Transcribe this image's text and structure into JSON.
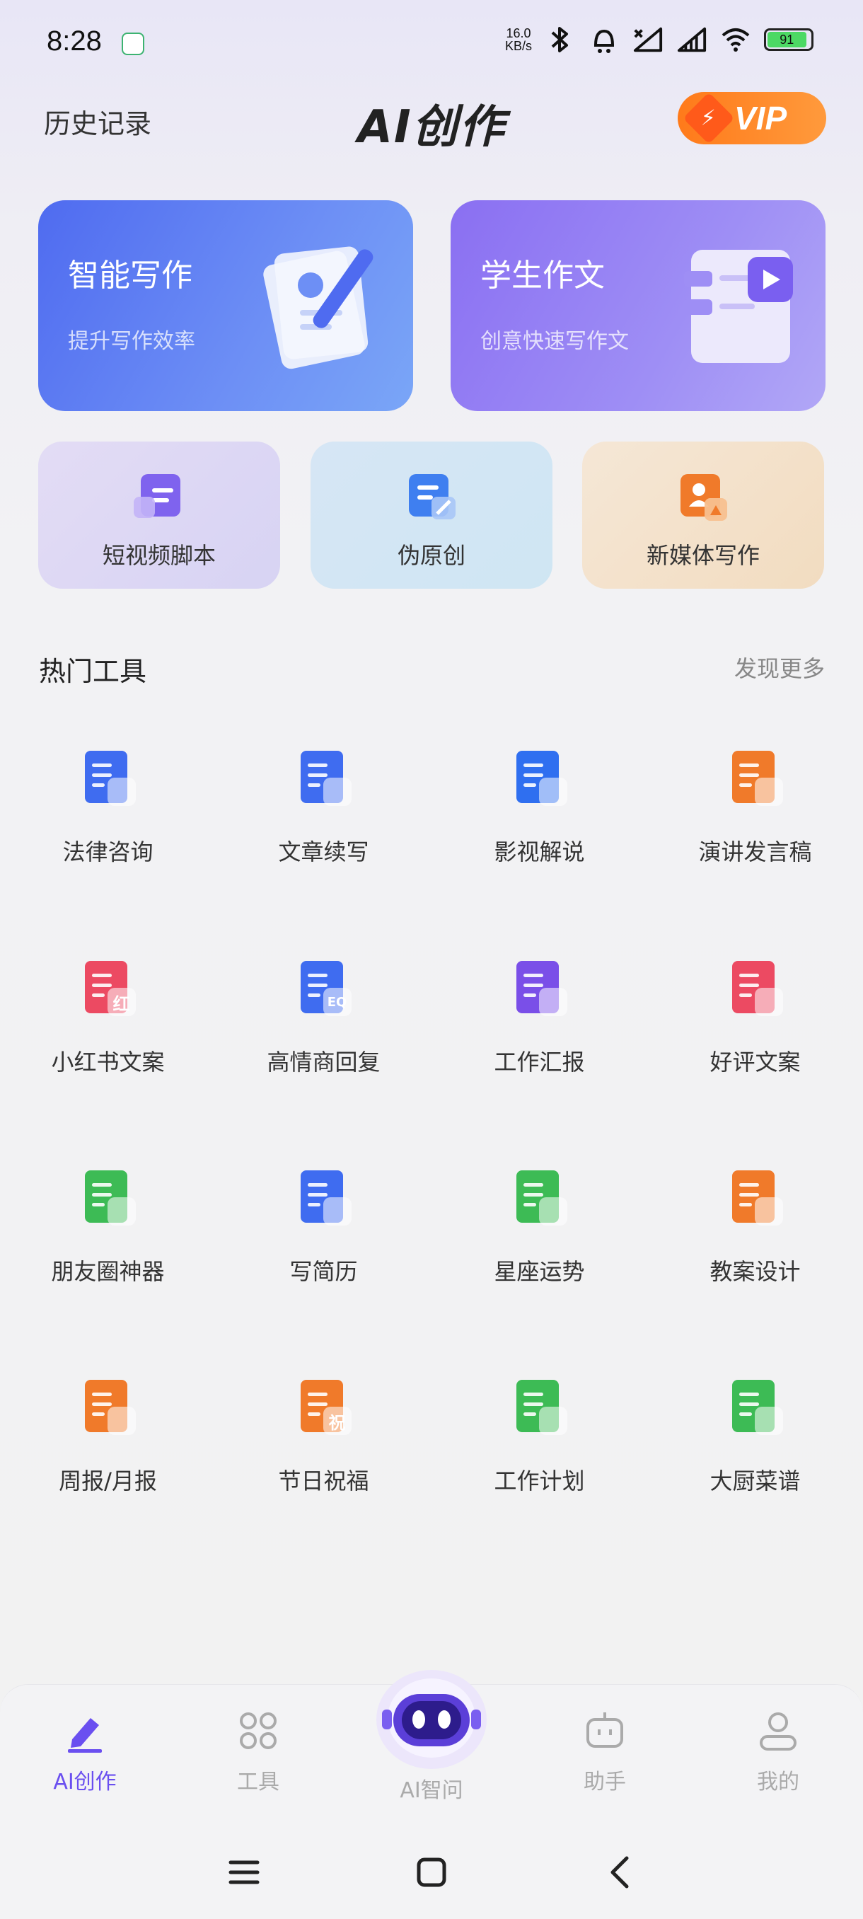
{
  "status_bar": {
    "time": "8:28",
    "net_speed_value": "16.0",
    "net_speed_unit": "KB/s",
    "battery": "91"
  },
  "header": {
    "history": "历史记录",
    "title": "AI创作",
    "vip": "VIP"
  },
  "big_cards": [
    {
      "title": "智能写作",
      "subtitle": "提升写作效率"
    },
    {
      "title": "学生作文",
      "subtitle": "创意快速写作文"
    }
  ],
  "small_cards": [
    {
      "label": "短视频脚本"
    },
    {
      "label": "伪原创"
    },
    {
      "label": "新媒体写作"
    }
  ],
  "section": {
    "title": "热门工具",
    "more": "发现更多"
  },
  "tools": [
    {
      "label": "法律咨询",
      "icon": "legal-doc-icon",
      "color": "#3f6cf0"
    },
    {
      "label": "文章续写",
      "icon": "edit-doc-icon",
      "color": "#3f6cf0"
    },
    {
      "label": "影视解说",
      "icon": "headphones-icon",
      "color": "#2f6ff0"
    },
    {
      "label": "演讲发言稿",
      "icon": "speech-doc-icon",
      "color": "#f07a2a"
    },
    {
      "label": "小红书文案",
      "icon": "red-note-icon",
      "color": "#ec4a62",
      "badge": "红"
    },
    {
      "label": "高情商回复",
      "icon": "eq-chat-icon",
      "color": "#3f6cf0",
      "badge": "EQ"
    },
    {
      "label": "工作汇报",
      "icon": "briefcase-icon",
      "color": "#7a4fe8"
    },
    {
      "label": "好评文案",
      "icon": "heart-doc-icon",
      "color": "#ec4a62"
    },
    {
      "label": "朋友圈神器",
      "icon": "moments-icon",
      "color": "#3dbb55"
    },
    {
      "label": "写简历",
      "icon": "resume-icon",
      "color": "#3f6cf0"
    },
    {
      "label": "星座运势",
      "icon": "star-icon",
      "color": "#3dbb55"
    },
    {
      "label": "教案设计",
      "icon": "lesson-plan-icon",
      "color": "#f07a2a"
    },
    {
      "label": "周报/月报",
      "icon": "report-icon",
      "color": "#f07a2a"
    },
    {
      "label": "节日祝福",
      "icon": "greeting-icon",
      "color": "#f07a2a",
      "badge": "祝"
    },
    {
      "label": "工作计划",
      "icon": "plan-clock-icon",
      "color": "#3dbb55"
    },
    {
      "label": "大厨菜谱",
      "icon": "chef-recipe-icon",
      "color": "#3dbb55"
    }
  ],
  "bottom_nav": [
    {
      "label": "AI创作",
      "active": true
    },
    {
      "label": "工具",
      "active": false
    },
    {
      "label": "AI智问",
      "active": false
    },
    {
      "label": "助手",
      "active": false
    },
    {
      "label": "我的",
      "active": false
    }
  ],
  "colors": {
    "accent": "#6a4ff0",
    "vip": "#ff7a1a"
  }
}
